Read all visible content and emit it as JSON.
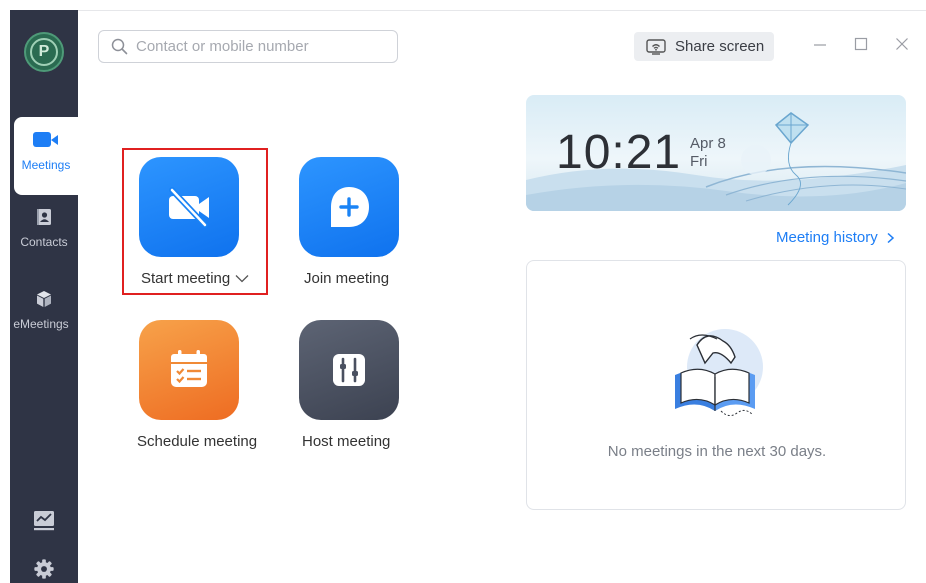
{
  "sidebar": {
    "logo_letter": "P",
    "items": [
      {
        "label": "Meetings",
        "icon": "video-camera-icon",
        "active": true
      },
      {
        "label": "Contacts",
        "icon": "contacts-book-icon",
        "active": false
      },
      {
        "label": "eMeetings",
        "icon": "cube-icon",
        "active": false
      }
    ],
    "bottom_icons": [
      "presentation-chart-icon",
      "gear-icon"
    ]
  },
  "search": {
    "placeholder": "Contact or mobile number",
    "value": ""
  },
  "toolbar": {
    "share_label": "Share screen"
  },
  "window_controls": [
    "minimize-icon",
    "maximize-icon",
    "close-icon"
  ],
  "actions": {
    "start_label": "Start meeting",
    "join_label": "Join meeting",
    "schedule_label": "Schedule meeting",
    "host_label": "Host meeting"
  },
  "clock": {
    "time": "10:21",
    "month_day": "Apr 8",
    "weekday": "Fri"
  },
  "meeting_history_label": "Meeting history",
  "empty_state_text": "No meetings in the next 30 days.",
  "colors": {
    "accent": "#1e7ef5",
    "sidebar": "#2f3445",
    "schedule": "#f0802e",
    "host": "#4a5060",
    "highlight": "#e02020"
  }
}
